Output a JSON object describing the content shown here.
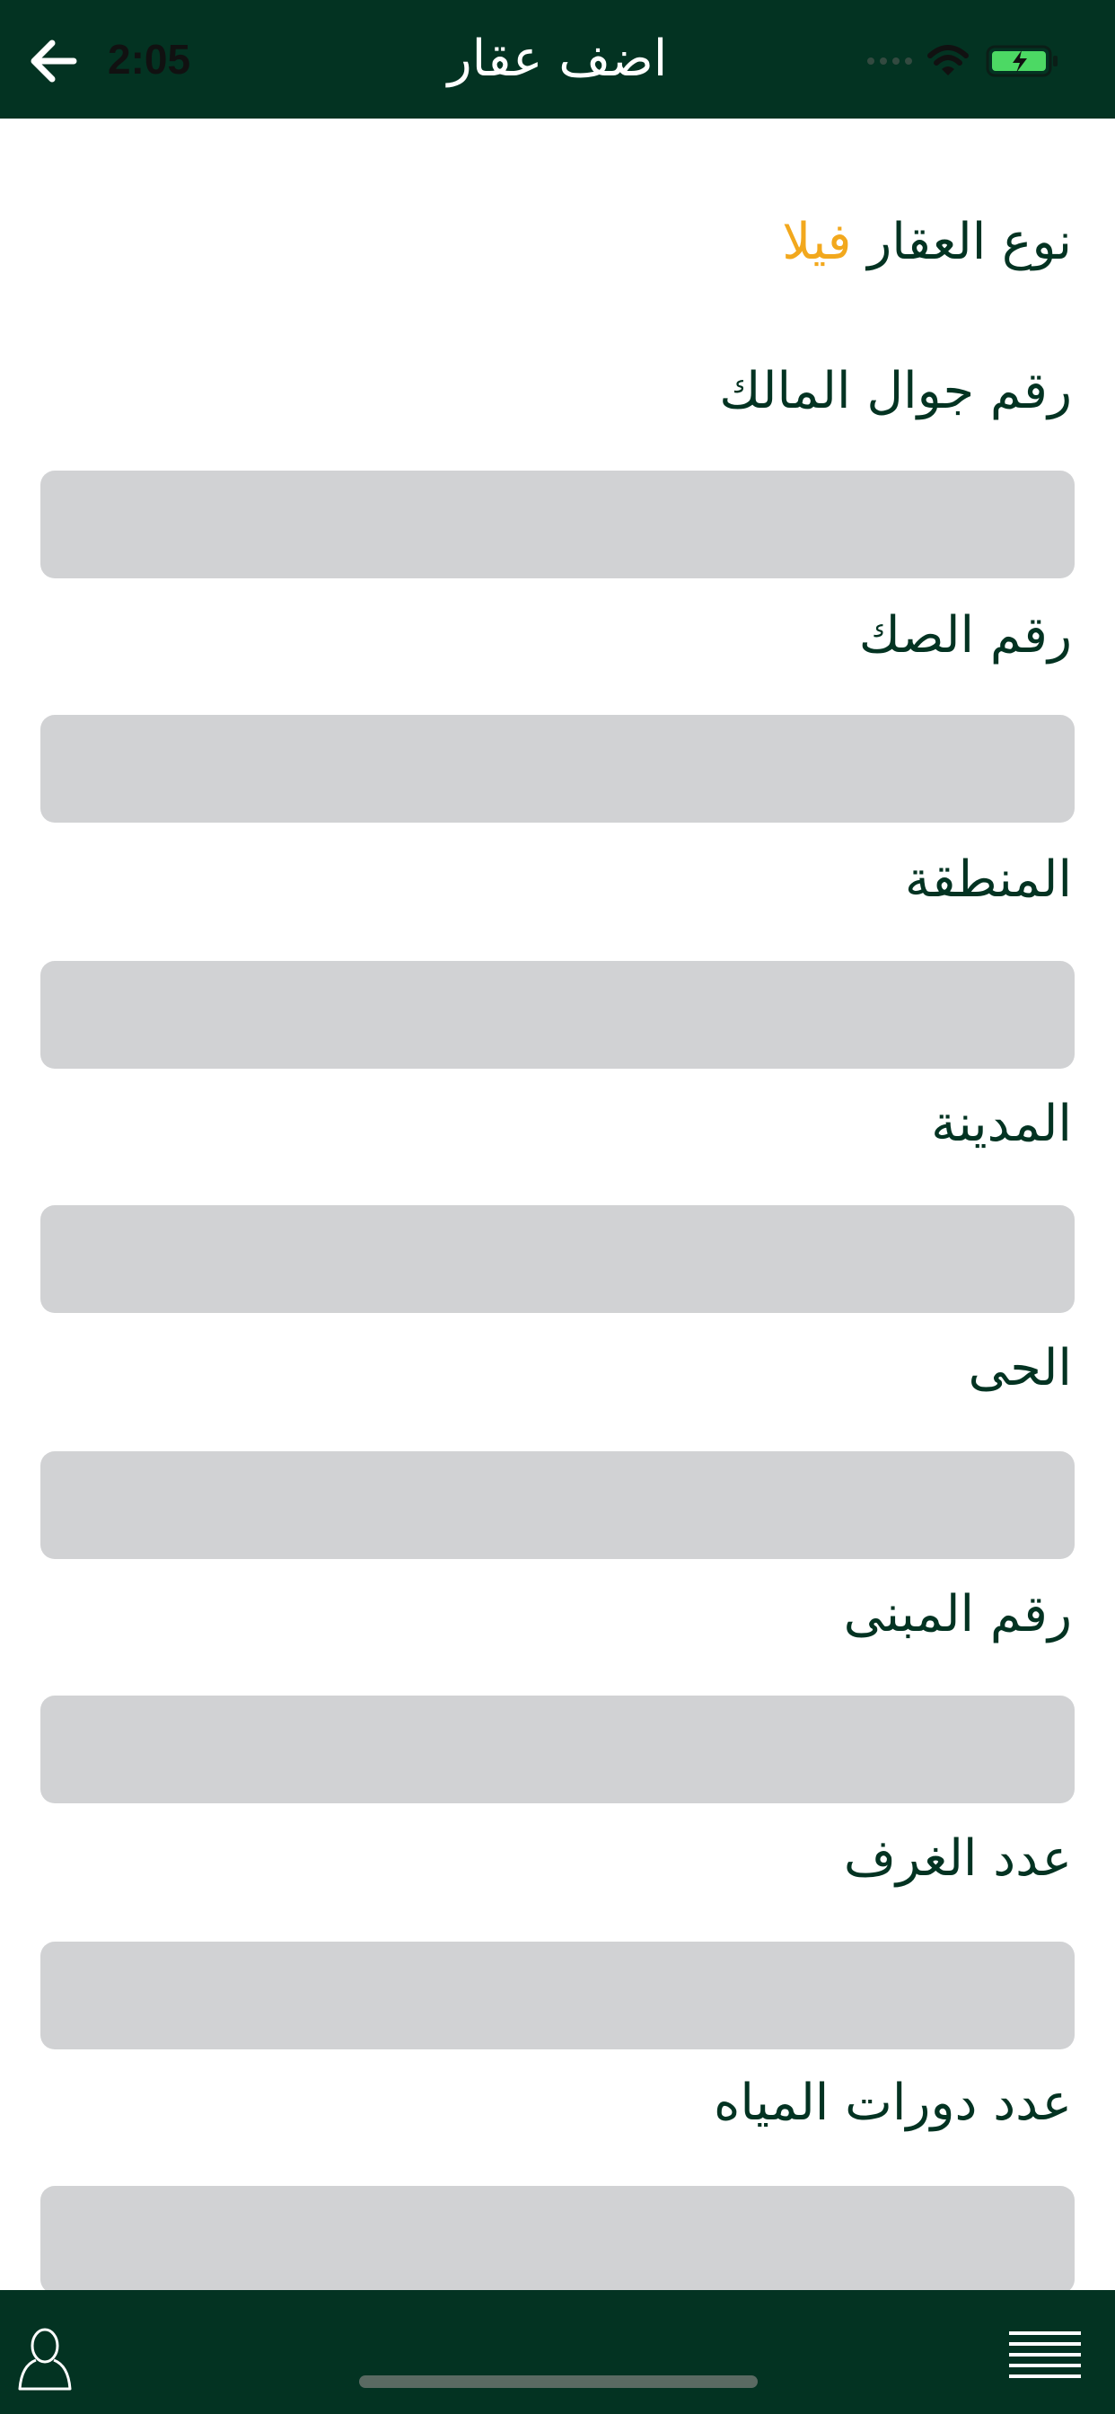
{
  "header": {
    "title": "اضف عقار",
    "status_time": "2:05"
  },
  "form": {
    "type_label": "نوع العقار",
    "type_value": "فيلا",
    "fields": [
      {
        "label": "رقم جوال المالك",
        "value": ""
      },
      {
        "label": "رقم الصك",
        "value": ""
      },
      {
        "label": "المنطقة",
        "value": ""
      },
      {
        "label": "المدينة",
        "value": ""
      },
      {
        "label": "الحى",
        "value": ""
      },
      {
        "label": "رقم المبنى",
        "value": ""
      },
      {
        "label": "عدد الغرف",
        "value": ""
      },
      {
        "label": "عدد دورات المياه",
        "value": ""
      }
    ]
  },
  "icons": {
    "back": "arrow-left-icon",
    "wifi": "wifi-icon",
    "battery": "battery-charging-icon",
    "profile": "user-icon",
    "menu": "menu-lines-icon"
  },
  "colors": {
    "header_bg": "#033322",
    "label_text": "#033322",
    "accent": "#f2a81d",
    "input_bg": "#d1d2d4"
  }
}
